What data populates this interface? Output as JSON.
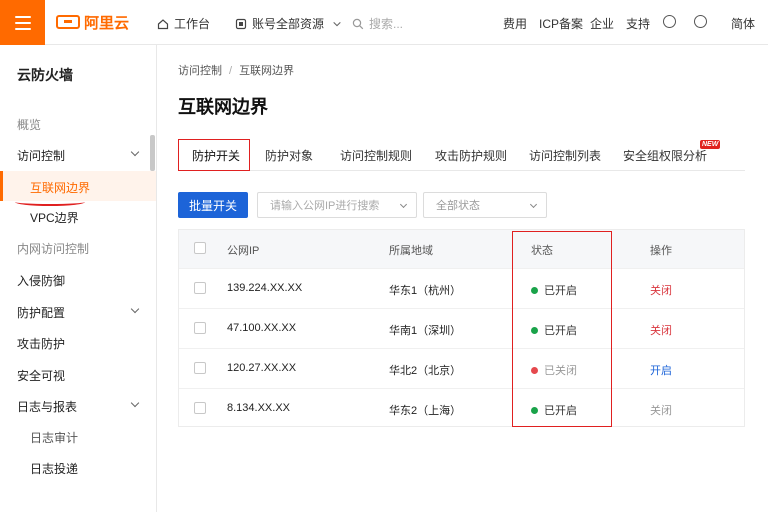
{
  "topbar": {
    "logo_text": "阿里云",
    "workbench": "工作台",
    "resources": "账号全部资源",
    "search_placeholder": "搜索...",
    "links": [
      "费用",
      "ICP备案",
      "企业",
      "支持"
    ],
    "language": "简体"
  },
  "sidebar": {
    "title": "云防火墙",
    "items": [
      {
        "label": "概览"
      },
      {
        "label": "访问控制"
      },
      {
        "label": "互联网边界"
      },
      {
        "label": "VPC边界"
      },
      {
        "label": "内网访问控制"
      },
      {
        "label": "入侵防御"
      },
      {
        "label": "防护配置"
      },
      {
        "label": "攻击防护"
      },
      {
        "label": "安全可视"
      },
      {
        "label": "日志与报表"
      },
      {
        "label": "日志审计"
      },
      {
        "label": "日志投递"
      }
    ]
  },
  "breadcrumb": [
    "访问控制",
    "互联网边界"
  ],
  "page_title": "互联网边界",
  "tabs": [
    {
      "label": "防护开关"
    },
    {
      "label": "防护对象"
    },
    {
      "label": "访问控制规则"
    },
    {
      "label": "攻击防护规则"
    },
    {
      "label": "访问控制列表"
    },
    {
      "label": "安全组权限分析"
    }
  ],
  "new_badge": "NEW",
  "toolbar": {
    "batch_button": "批量开关",
    "search_placeholder": "请输入公网IP进行搜索",
    "status_filter": "全部状态"
  },
  "table": {
    "columns": [
      "公网IP",
      "所属地域",
      "状态",
      "操作"
    ],
    "rows": [
      {
        "ip": "139.224.XX.XX",
        "region": "华东1（杭州）",
        "status": "已开启",
        "status_color": "#1aa34a",
        "action": "关闭",
        "action_color": "#d9363e"
      },
      {
        "ip": "47.100.XX.XX",
        "region": "华南1（深圳）",
        "status": "已开启",
        "status_color": "#1aa34a",
        "action": "关闭",
        "action_color": "#d9363e"
      },
      {
        "ip": "120.27.XX.XX",
        "region": "华北2（北京）",
        "status": "已关闭",
        "status_color": "#e5484d",
        "action": "开启",
        "action_color": "#1d64d8"
      },
      {
        "ip": "8.134.XX.XX",
        "region": "华东2（上海）",
        "status": "已开启",
        "status_color": "#1aa34a",
        "action": "关闭",
        "action_color": "#999999"
      }
    ]
  },
  "colors": {
    "brand": "#ff6a00",
    "primary": "#1d64d8",
    "highlight": "#e02020"
  }
}
